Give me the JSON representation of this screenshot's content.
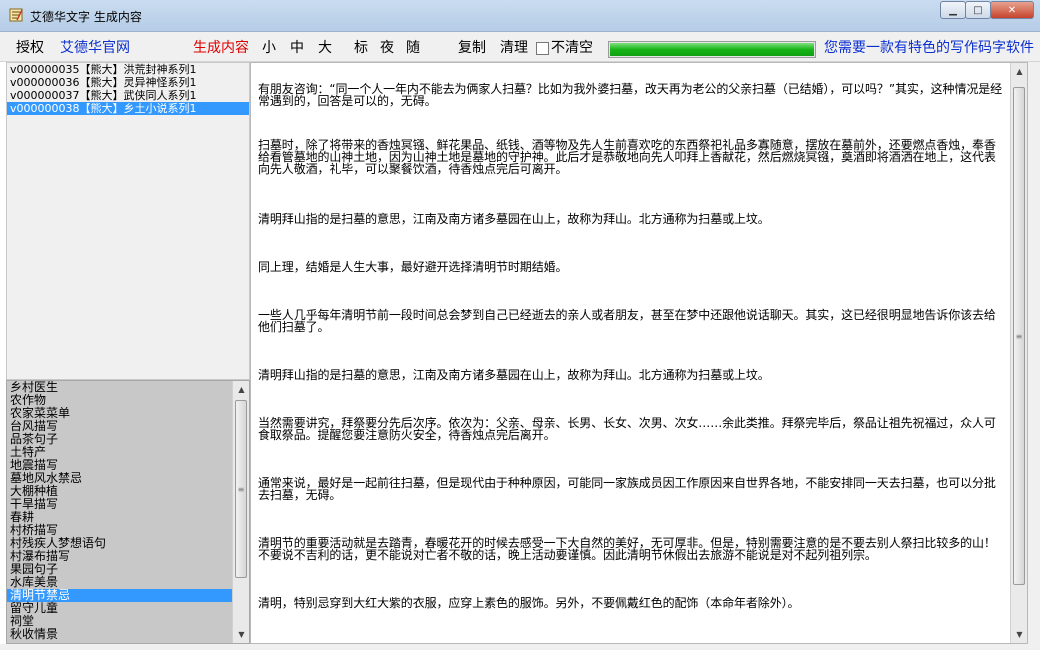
{
  "window": {
    "title": "艾德华文字 生成内容",
    "controls": {
      "minimize": "▁",
      "maximize": "□",
      "close": "✕"
    }
  },
  "toolbar": {
    "license": "授权",
    "official_site": "艾德华官网",
    "generate": "生成内容",
    "size_small": "小",
    "size_medium": "中",
    "size_large": "大",
    "mode_standard": "标",
    "mode_night": "夜",
    "mode_random": "随",
    "copy": "复制",
    "clear": "清理",
    "no_clear_label": "不清空",
    "no_clear_checked": false,
    "progress": 1.0,
    "promo": "您需要一款有特色的写作码字软件"
  },
  "projects": {
    "selected_index": 3,
    "items": [
      "v000000035【熊大】洪荒封神系列1",
      "v000000036【熊大】灵异神怪系列1",
      "v000000037【熊大】武侠同人系列1",
      "v000000038【熊大】乡土小说系列1"
    ]
  },
  "topics": {
    "selected_index": 16,
    "items": [
      "乡村医生",
      "农作物",
      "农家菜菜单",
      "台风描写",
      "品茶句子",
      "土特产",
      "地震描写",
      "墓地风水禁忌",
      "大棚种植",
      "干旱描写",
      "春耕",
      "村桥描写",
      "村残疾人梦想语句",
      "村瀑布描写",
      "果园句子",
      "水库美景",
      "清明节禁忌",
      "留守儿童",
      "祠堂",
      "秋收情景"
    ]
  },
  "content": {
    "paragraphs": [
      "有朋友咨询：“同一个人一年内不能去为俩家人扫墓？比如为我外婆扫墓，改天再为老公的父亲扫墓（已结婚），可以吗？”其实，这种情况是经常遇到的，回答是可以的，无碍。",
      "扫墓时，除了将带来的香烛冥镪、鲜花果品、纸钱、酒等物及先人生前喜欢吃的东西祭祀礼品多寡随意，摆放在墓前外，还要燃点香烛，奉香给看管墓地的山神土地，因为山神土地是墓地的守护神。此后才是恭敬地向先人叩拜上香献花，然后燃烧冥镪，奠酒即将酒洒在地上，这代表向先人敬酒，礼毕，可以聚餐饮酒，待香烛点完后可离开。",
      "清明拜山指的是扫墓的意思，江南及南方诸多墓园在山上，故称为拜山。北方通称为扫墓或上坟。",
      "同上理，结婚是人生大事，最好避开选择清明节时期结婚。",
      "一些人几乎每年清明节前一段时间总会梦到自己已经逝去的亲人或者朋友，甚至在梦中还跟他说话聊天。其实，这已经很明显地告诉你该去给他们扫墓了。",
      "清明拜山指的是扫墓的意思，江南及南方诸多墓园在山上，故称为拜山。北方通称为扫墓或上坟。",
      "当然需要讲究，拜祭要分先后次序。依次为：父亲、母亲、长男、长女、次男、次女……余此类推。拜祭完毕后，祭品让祖先祝福过，众人可食取祭品。提醒您要注意防火安全，待香烛点完后离开。",
      "通常来说，最好是一起前往扫墓，但是现代由于种种原因，可能同一家族成员因工作原因来自世界各地，不能安排同一天去扫墓，也可以分批去扫墓，无碍。",
      "清明节的重要活动就是去踏青，春暖花开的时候去感受一下大自然的美好，无可厚非。但是，特别需要注意的是不要去别人祭扫比较多的山！不要说不吉利的话，更不能说对亡者不敬的话，晚上活动要谨慎。因此清明节休假出去旅游不能说是对不起列祖列宗。",
      "清明，特别忌穿到大红大紫的衣服，应穿上素色的服饰。另外，不要佩戴红色的配饰（本命年者除外）。"
    ]
  },
  "colors": {
    "link_blue": "#0b2fcf",
    "generate_red": "#e00000",
    "selection": "#3399ff",
    "progress_green": "#17b417"
  },
  "icons": {
    "app": "app-icon",
    "scroll_up": "arrow-up-icon",
    "scroll_down": "arrow-down-icon",
    "scroll_grip": "grip-icon"
  }
}
